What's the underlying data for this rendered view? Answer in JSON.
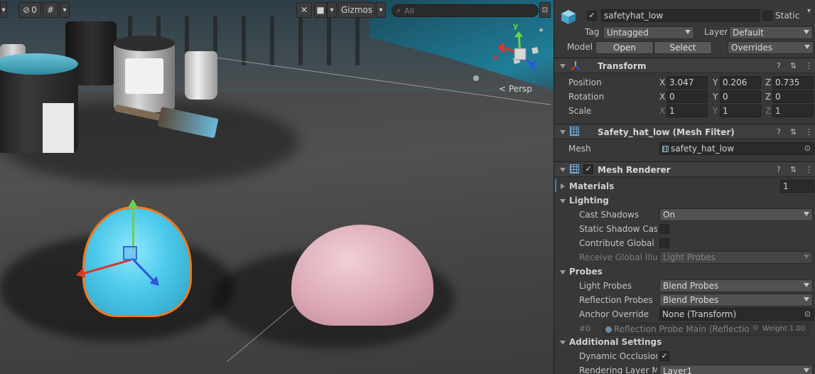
{
  "scene": {
    "toolbar": {
      "hidden_count": "0",
      "gizmos_label": "Gizmos",
      "search_placeholder": "All"
    },
    "orientation": {
      "y_axis": "y",
      "x_axis": "x",
      "z_axis": "z",
      "projection_label": "Persp"
    }
  },
  "inspector": {
    "object_name": "safetyhat_low",
    "static_label": "Static",
    "tag_label": "Tag",
    "tag_value": "Untagged",
    "layer_label": "Layer",
    "layer_value": "Default",
    "model_label": "Model",
    "open_button": "Open",
    "select_button": "Select",
    "overrides_value": "Overrides",
    "transform": {
      "title": "Transform",
      "position_label": "Position",
      "rotation_label": "Rotation",
      "scale_label": "Scale",
      "position": {
        "x": "3.047",
        "y": "0.206",
        "z": "0.735"
      },
      "rotation": {
        "x": "0",
        "y": "0",
        "z": "0"
      },
      "scale": {
        "x": "1",
        "y": "1",
        "z": "1"
      },
      "axis_x": "X",
      "axis_y": "Y",
      "axis_z": "Z"
    },
    "mesh_filter": {
      "title": "Safety_hat_low (Mesh Filter)",
      "mesh_label": "Mesh",
      "mesh_value": "safety_hat_low"
    },
    "mesh_renderer": {
      "title": "Mesh Renderer",
      "materials_label": "Materials",
      "materials_count": "1",
      "lighting_label": "Lighting",
      "cast_shadows_label": "Cast Shadows",
      "cast_shadows_value": "On",
      "static_shadow_caster_label": "Static Shadow Caster",
      "contribute_gi_label": "Contribute Global Illumination",
      "receive_gi_label": "Receive Global Illumination",
      "receive_gi_value": "Light Probes",
      "probes_label": "Probes",
      "light_probes_label": "Light Probes",
      "light_probes_value": "Blend Probes",
      "reflection_probes_label": "Reflection Probes",
      "reflection_probes_value": "Blend Probes",
      "anchor_override_label": "Anchor Override",
      "anchor_override_value": "None (Transform)",
      "probe_index": "#0",
      "probe_name": "Reflection Probe Main (Reflection",
      "probe_weight": "Weight 1.00",
      "additional_settings_label": "Additional Settings",
      "dynamic_occlusion_label": "Dynamic Occlusion",
      "rendering_layer_label": "Rendering Layer Mask",
      "rendering_layer_value": "Layer1"
    }
  }
}
